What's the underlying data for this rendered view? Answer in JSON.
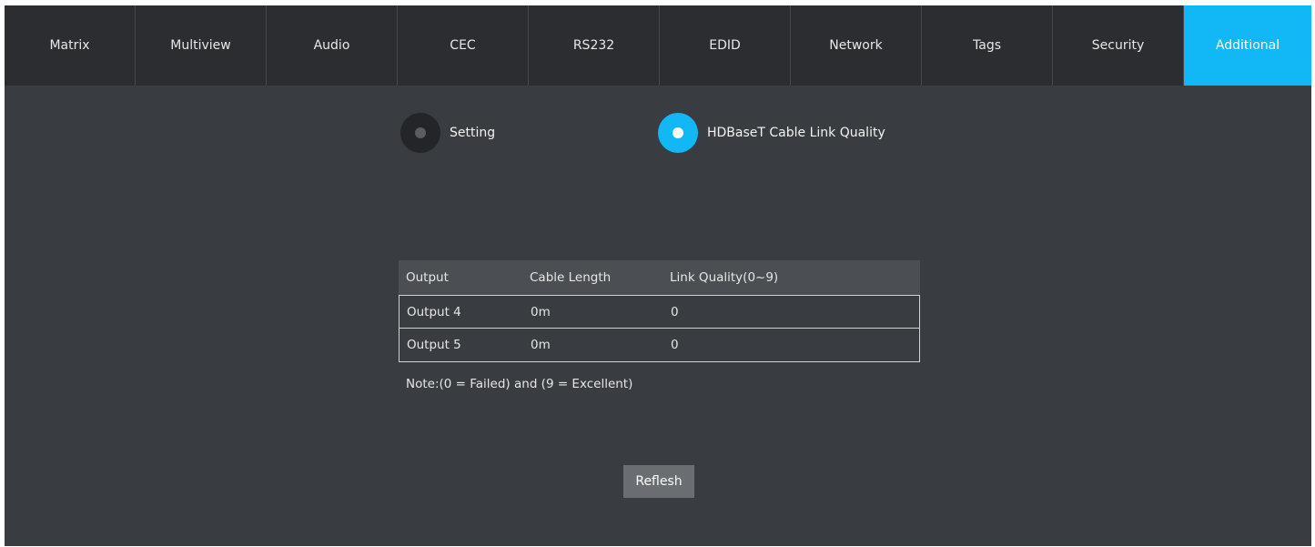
{
  "tabs": [
    {
      "label": "Matrix"
    },
    {
      "label": "Multiview"
    },
    {
      "label": "Audio"
    },
    {
      "label": "CEC"
    },
    {
      "label": "RS232"
    },
    {
      "label": "EDID"
    },
    {
      "label": "Network"
    },
    {
      "label": "Tags"
    },
    {
      "label": "Security"
    },
    {
      "label": "Additional",
      "active": true
    }
  ],
  "mode": {
    "setting_label": "Setting",
    "hdbaset_label": "HDBaseT Cable Link Quality",
    "selected": "HDBaseT Cable Link Quality"
  },
  "table": {
    "headers": [
      "Output",
      "Cable Length",
      "Link Quality(0~9)"
    ],
    "rows": [
      [
        "Output 4",
        "0m",
        "0"
      ],
      [
        "Output 5",
        "0m",
        "0"
      ]
    ]
  },
  "note": "Note:(0 = Failed) and (9 = Excellent)",
  "refresh_label": "Reflesh",
  "colors": {
    "accent": "#12b7f5",
    "background": "#393c40",
    "tabbar": "#2b2d30"
  }
}
